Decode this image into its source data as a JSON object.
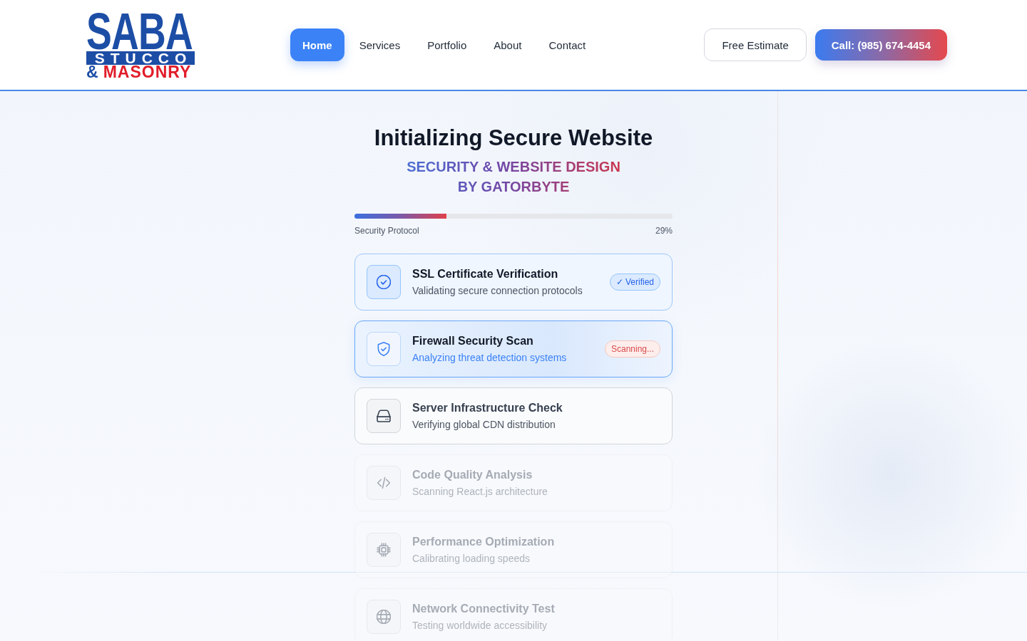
{
  "logo": {
    "name": "SABA",
    "band": "STUCCO",
    "ampersand": "&",
    "trade": "MASONRY"
  },
  "nav": [
    {
      "label": "Home",
      "selected": true
    },
    {
      "label": "Services",
      "selected": false
    },
    {
      "label": "Portfolio",
      "selected": false
    },
    {
      "label": "About",
      "selected": false
    },
    {
      "label": "Contact",
      "selected": false
    }
  ],
  "actions": [
    {
      "label": "Free Estimate",
      "kind": "outline"
    },
    {
      "label": "Call: (985) 674-4454",
      "kind": "primary"
    }
  ],
  "loader": {
    "title": "Initializing Secure Website",
    "tagline": "SECURITY & WEBSITE DESIGN BY GATORBYTE",
    "progress": {
      "label": "Security Protocol",
      "reading": "29%",
      "level": 0.29
    },
    "steps": [
      {
        "title": "SSL Certificate Verification",
        "detail": "Validating secure connection protocols",
        "done": true,
        "active": false,
        "dimmed": false,
        "badge": "✓ Verified"
      },
      {
        "title": "Firewall Security Scan",
        "detail": "Analyzing threat detection systems",
        "done": false,
        "active": true,
        "dimmed": false,
        "badge": "Scanning..."
      },
      {
        "title": "Server Infrastructure Check",
        "detail": "Verifying global CDN distribution",
        "done": false,
        "active": false,
        "dimmed": false
      },
      {
        "title": "Code Quality Analysis",
        "detail": "Scanning React.js architecture",
        "done": false,
        "active": false,
        "dimmed": true
      },
      {
        "title": "Performance Optimization",
        "detail": "Calibrating loading speeds",
        "done": false,
        "active": false,
        "dimmed": true
      },
      {
        "title": "Network Connectivity Test",
        "detail": "Testing worldwide accessibility",
        "done": false,
        "active": false,
        "dimmed": true
      }
    ]
  }
}
